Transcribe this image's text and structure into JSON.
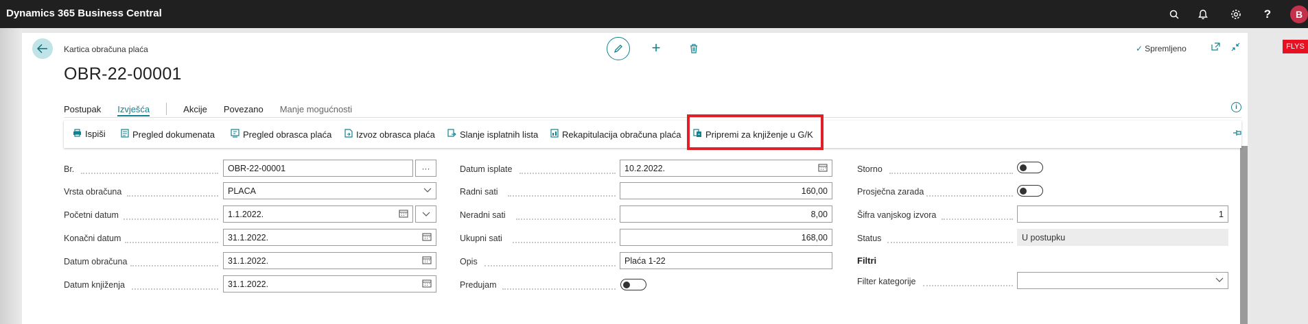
{
  "app": {
    "title": "Dynamics 365 Business Central",
    "avatar_initial": "B"
  },
  "topbar_icons": [
    "search-icon",
    "bell-icon",
    "gear-icon",
    "help-icon"
  ],
  "page": {
    "breadcrumb": "Kartica obračuna plaća",
    "title": "OBR-22-00001",
    "saved_label": "Spremljeno",
    "badge": "FLYS"
  },
  "tabs": [
    {
      "label": "Postupak"
    },
    {
      "label": "Izvješća",
      "active": true
    },
    {
      "label": "Akcije"
    },
    {
      "label": "Povezano"
    },
    {
      "label": "Manje mogućnosti"
    }
  ],
  "actions": [
    {
      "label": "Ispiši",
      "icon": "printer-icon"
    },
    {
      "label": "Pregled dokumenata",
      "icon": "document-view-icon"
    },
    {
      "label": "Pregled obrasca plaća",
      "icon": "form-view-icon"
    },
    {
      "label": "Izvoz obrasca plaća",
      "icon": "export-icon"
    },
    {
      "label": "Slanje isplatnih lista",
      "icon": "send-icon"
    },
    {
      "label": "Rekapitulacija obračuna plaća",
      "icon": "report-icon"
    },
    {
      "label": "Pripremi za knjiženje u G/K",
      "icon": "post-prepare-icon",
      "highlighted": true
    }
  ],
  "fields": {
    "col1": {
      "br": {
        "label": "Br.",
        "value": "OBR-22-00001"
      },
      "vrsta": {
        "label": "Vrsta obračuna",
        "value": "PLACA"
      },
      "pocetni": {
        "label": "Početni datum",
        "value": "1.1.2022."
      },
      "konacni": {
        "label": "Konačni datum",
        "value": "31.1.2022."
      },
      "datum_obr": {
        "label": "Datum obračuna",
        "value": "31.1.2022."
      },
      "datum_knj": {
        "label": "Datum knjiženja",
        "value": "31.1.2022."
      }
    },
    "col2": {
      "datum_isplate": {
        "label": "Datum isplate",
        "value": "10.2.2022."
      },
      "radni_sati": {
        "label": "Radni sati",
        "value": "160,00"
      },
      "neradni_sati": {
        "label": "Neradni sati",
        "value": "8,00"
      },
      "ukupni_sati": {
        "label": "Ukupni sati",
        "value": "168,00"
      },
      "opis": {
        "label": "Opis",
        "value": "Plaća 1-22"
      },
      "predujam": {
        "label": "Predujam",
        "value": false
      }
    },
    "col3": {
      "storno": {
        "label": "Storno",
        "value": false
      },
      "prosjecna": {
        "label": "Prosječna zarada",
        "value": false
      },
      "sifra": {
        "label": "Šifra vanjskog izvora",
        "value": "1"
      },
      "status": {
        "label": "Status",
        "value": "U postupku"
      },
      "filtri": {
        "label": "Filtri"
      },
      "filter_kat": {
        "label": "Filter kategorije",
        "value": ""
      }
    }
  },
  "colors": {
    "accent": "#0f8291",
    "highlight": "#e01f26",
    "topbar": "#202020",
    "badge": "#e81123"
  }
}
